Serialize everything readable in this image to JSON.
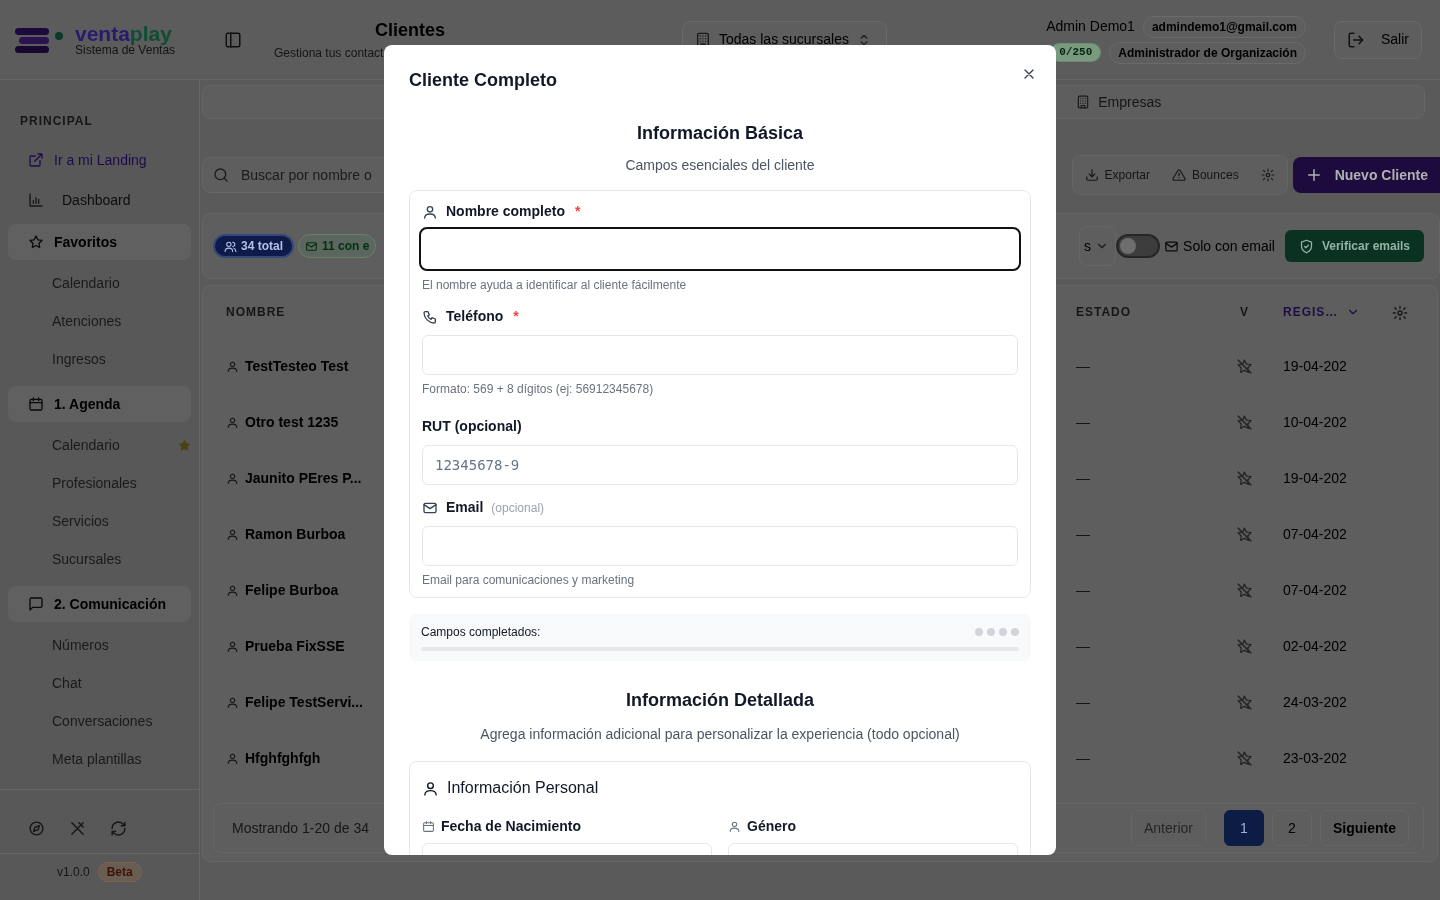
{
  "header": {
    "brand": [
      {
        "text": "venta",
        "color": "#2a1a6e"
      },
      {
        "text": "play",
        "color": "#0f4d35"
      }
    ],
    "tagline": "Sistema de Ventas",
    "title": "Clientes",
    "subtitle": "Gestiona tus contact",
    "branch_select": "Todas las sucursales",
    "user_name": "Admin Demo1",
    "user_email": "admindemo1@gmail.com",
    "quota": "0/250",
    "role": "Administrador de Organización",
    "logout": "Salir"
  },
  "sidebar": {
    "section": "PRINCIPAL",
    "links": [
      {
        "label": "Ir a mi Landing",
        "kind": "external"
      },
      {
        "label": "Dashboard",
        "kind": "plain"
      }
    ],
    "groups": [
      {
        "label": "Favoritos",
        "children": [
          {
            "label": "Calendario",
            "favorite": false
          },
          {
            "label": "Atenciones",
            "favorite": false
          },
          {
            "label": "Ingresos",
            "favorite": false
          }
        ]
      },
      {
        "label": "1. Agenda",
        "children": [
          {
            "label": "Calendario",
            "favorite": true
          },
          {
            "label": "Profesionales",
            "favorite": false
          },
          {
            "label": "Servicios",
            "favorite": false
          },
          {
            "label": "Sucursales",
            "favorite": false
          }
        ]
      },
      {
        "label": "2. Comunicación",
        "children": [
          {
            "label": "Números",
            "favorite": false
          },
          {
            "label": "Chat",
            "favorite": false
          },
          {
            "label": "Conversaciones",
            "favorite": false
          },
          {
            "label": "Meta plantillas",
            "favorite": false
          }
        ]
      }
    ],
    "version": "v1.0.0",
    "channel": "Beta"
  },
  "tabs": [
    {
      "label": "Empresas",
      "selected": false
    }
  ],
  "toolbar": {
    "search": {
      "placeholder": "Buscar por nombre o"
    },
    "actions": [
      "Exportar",
      "Bounces"
    ],
    "new_button": "Nuevo Cliente"
  },
  "filters": {
    "badges": [
      {
        "label": "34 total",
        "kind": "total"
      },
      {
        "label": "11 con e",
        "kind": "email"
      }
    ],
    "select_tail": "s",
    "toggle": {
      "label": "Solo con email",
      "on": false
    },
    "verify_button": "Verificar emails"
  },
  "table": {
    "columns": [
      "NOMBRE",
      "ESTADO",
      "V",
      "REGIS…"
    ],
    "rows": [
      {
        "name": "TestTesteo Test",
        "status": "—",
        "verified": false,
        "date": "19-04-202"
      },
      {
        "name": "Otro test 1235",
        "status": "—",
        "verified": false,
        "date": "10-04-202"
      },
      {
        "name": "Jaunito PEres P...",
        "status": "—",
        "verified": false,
        "date": "19-04-202"
      },
      {
        "name": "Ramon Burboa",
        "status": "—",
        "verified": false,
        "date": "07-04-202"
      },
      {
        "name": "Felipe Burboa",
        "status": "—",
        "verified": false,
        "date": "07-04-202"
      },
      {
        "name": "Prueba FixSSE",
        "status": "—",
        "verified": false,
        "date": "02-04-202"
      },
      {
        "name": "Felipe TestServi...",
        "status": "—",
        "verified": false,
        "date": "24-03-202"
      },
      {
        "name": "Hfghfghfgh",
        "status": "—",
        "verified": false,
        "date": "23-03-202"
      }
    ]
  },
  "pagination": {
    "summary": "Mostrando 1-20 de 34",
    "previous": {
      "label": "Anterior",
      "disabled": true
    },
    "pages": [
      {
        "label": "1",
        "selected": true
      },
      {
        "label": "2",
        "selected": false
      }
    ],
    "next": {
      "label": "Siguiente",
      "disabled": false
    }
  },
  "modal": {
    "title": "Cliente Completo",
    "basic": {
      "heading": "Información Básica",
      "subheading": "Campos esenciales del cliente",
      "fields": [
        {
          "kind": "person",
          "label": "Nombre completo",
          "required": true,
          "required_mark": "*",
          "focused": true,
          "help": "El nombre ayuda a identificar al cliente fácilmente"
        },
        {
          "kind": "phone",
          "label": "Teléfono",
          "required": true,
          "required_mark": "*",
          "focused": false,
          "help": "Formato: 569 + 8 dígitos (ej: 56912345678)"
        },
        {
          "kind": "plain",
          "label": "RUT (opcional)",
          "required": false,
          "focused": false,
          "placeholder": "12345678-9"
        },
        {
          "kind": "mail",
          "label": "Email",
          "note": "(opcional)",
          "required": false,
          "focused": false,
          "help": "Email para comunicaciones y marketing"
        }
      ]
    },
    "progress": {
      "label": "Campos completados:",
      "dots": [
        {
          "filled": false
        },
        {
          "filled": false
        },
        {
          "filled": false
        },
        {
          "filled": false
        }
      ],
      "level": 0
    },
    "detailed": {
      "heading": "Información Detallada",
      "subheading": "Agrega información adicional para personalizar la experiencia (todo opcional)",
      "section_title": "Información Personal",
      "fields": [
        {
          "kind": "date",
          "label": "Fecha de Nacimiento"
        },
        {
          "kind": "person",
          "label": "Género"
        }
      ]
    }
  }
}
